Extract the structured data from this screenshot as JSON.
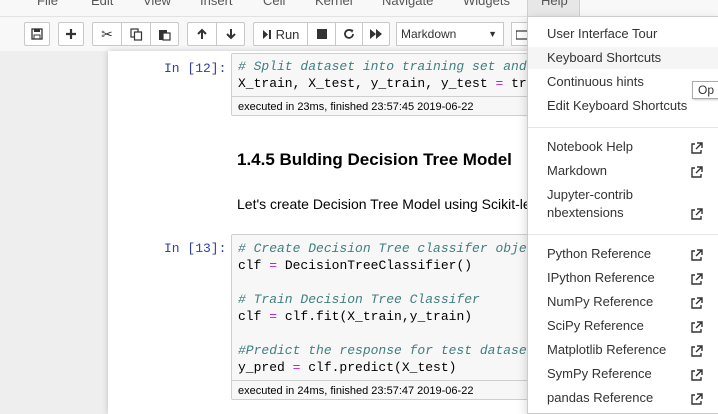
{
  "menubar": {
    "items": [
      "File",
      "Edit",
      "View",
      "Insert",
      "Cell",
      "Kernel",
      "Navigate",
      "Widgets"
    ],
    "help": "Help"
  },
  "toolbar": {
    "run_label": "Run",
    "cell_type": "Markdown"
  },
  "cells": [
    {
      "prompt": "In [12]:",
      "lines": [
        "# Split dataset into training set and",
        "X_train, X_test, y_train, y_test = tr"
      ],
      "exec": "executed in 23ms, finished 23:57:45 2019-06-22"
    },
    {
      "prompt": "In [13]:",
      "lines": [
        "# Create Decision Tree classifer obje",
        "clf = DecisionTreeClassifier()",
        "",
        "# Train Decision Tree Classifer",
        "clf = clf.fit(X_train,y_train)",
        "",
        "#Predict the response for test datase",
        "y_pred = clf.predict(X_test)"
      ],
      "exec": "executed in 24ms, finished 23:57:47 2019-06-22"
    }
  ],
  "markdown": {
    "heading": "1.4.5  Bulding Decision Tree Model",
    "paragraph": "Let's create Decision Tree Model using Scikit-learn."
  },
  "help_menu": {
    "group1": [
      "User Interface Tour",
      "Keyboard Shortcuts",
      "Continuous hints",
      "Edit Keyboard Shortcuts"
    ],
    "group2": [
      "Notebook Help",
      "Markdown"
    ],
    "jupyter_contrib": [
      "Jupyter-contrib",
      "nbextensions"
    ],
    "group3": [
      "Python Reference",
      "IPython Reference",
      "NumPy Reference",
      "SciPy Reference",
      "Matplotlib Reference",
      "SymPy Reference",
      "pandas Reference"
    ]
  },
  "tooltip": "Op"
}
